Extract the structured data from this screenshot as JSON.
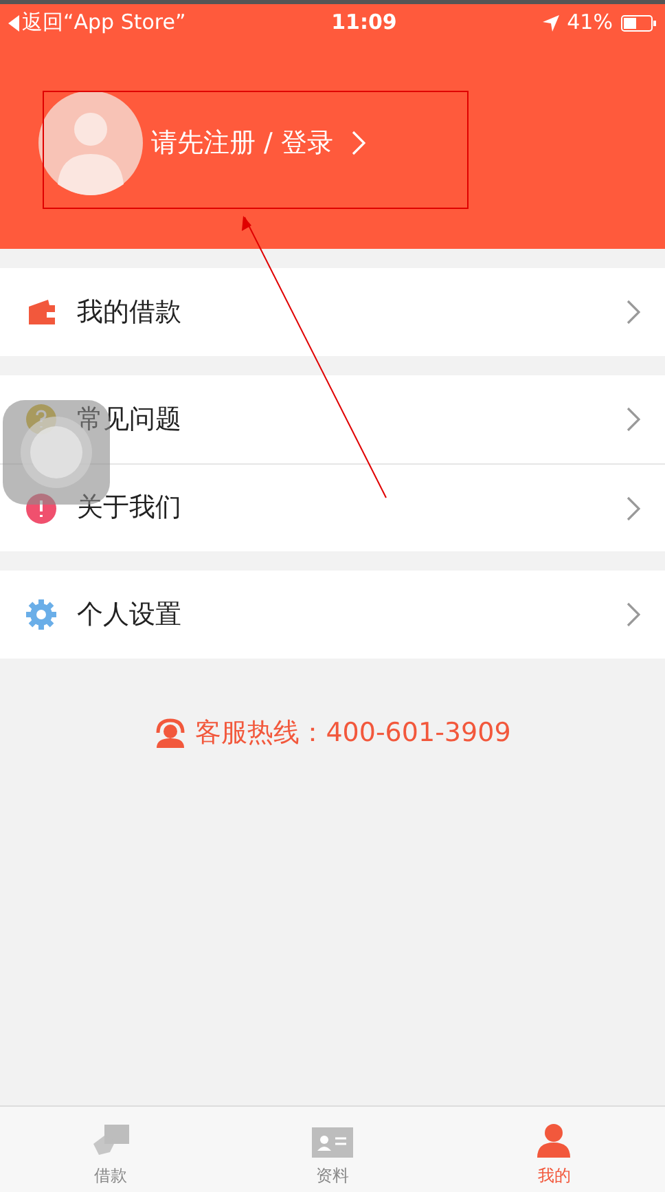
{
  "status_bar": {
    "back": "返回“App Store”",
    "time": "11:09",
    "battery": "41%"
  },
  "profile": {
    "login_text": "请先注册 / 登录"
  },
  "menu_groups": [
    {
      "items": [
        {
          "kind": "wallet",
          "label": "我的借款"
        }
      ]
    },
    {
      "items": [
        {
          "kind": "question",
          "label": "常见问题"
        },
        {
          "kind": "info",
          "label": "关于我们"
        }
      ]
    },
    {
      "items": [
        {
          "kind": "settings",
          "label": "个人设置"
        }
      ]
    }
  ],
  "hotline": {
    "label": "客服热线：400-601-3909"
  },
  "tabs": [
    {
      "kind": "loan",
      "label": "借款",
      "selected": false
    },
    {
      "kind": "profile-card",
      "label": "资料",
      "selected": false
    },
    {
      "kind": "person",
      "label": "我的",
      "selected": true
    }
  ]
}
